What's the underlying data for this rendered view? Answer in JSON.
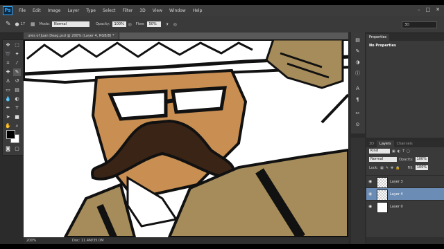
{
  "menubar": {
    "logo": "Ps",
    "items": [
      "File",
      "Edit",
      "Image",
      "Layer",
      "Type",
      "Select",
      "Filter",
      "3D",
      "View",
      "Window",
      "Help"
    ],
    "window_controls": [
      "–",
      "□",
      "✕"
    ]
  },
  "options": {
    "brush_size": "17",
    "mode_label": "Mode:",
    "mode_value": "Normal",
    "opacity_label": "Opacity:",
    "opacity_value": "100%",
    "flow_label": "Flow:",
    "flow_value": "50%",
    "workspace": "3D"
  },
  "document": {
    "tab_title": "ures of Juan Deag.psd @ 200% (Layer 4, RGB/8) *",
    "zoom": "200%",
    "doc_size": "Doc: 11.4M/35.0M"
  },
  "properties_panel": {
    "tab": "Properties",
    "body": "No Properties"
  },
  "layers_panel": {
    "tabs": [
      "3D",
      "Layers",
      "Channels"
    ],
    "filter_label": "Kind",
    "blend_mode": "Normal",
    "opacity_label": "Opacity:",
    "opacity_value": "100%",
    "lock_label": "Lock:",
    "fill_label": "Fill:",
    "fill_value": "100%",
    "layers": [
      {
        "name": "Layer 3",
        "selected": false
      },
      {
        "name": "Layer 4",
        "selected": true
      },
      {
        "name": "Layer 0",
        "selected": false
      }
    ]
  },
  "colors": {
    "skin": "#c98f52",
    "mustache": "#3a2416",
    "uniform": "#a58c5a",
    "selection": "#6b8db5"
  }
}
